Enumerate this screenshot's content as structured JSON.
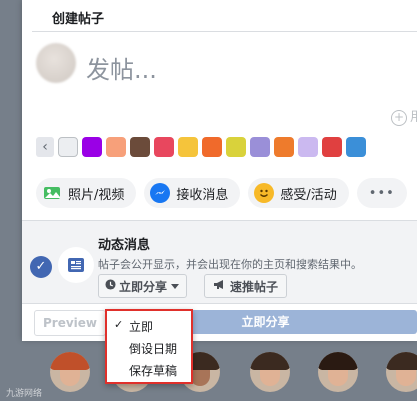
{
  "dialog": {
    "title": "创建帖子",
    "post_placeholder": "发帖...",
    "tag_hint": "用"
  },
  "backgrounds": {
    "prev_arrow": "‹",
    "swatches": [
      "#eceef1",
      "#9a00e6",
      "#f7a07a",
      "#6b4b3a",
      "#e8475e",
      "#f5c43b",
      "#f06a2b",
      "#d9d23b",
      "#9a8fd8",
      "#ee7b2c",
      "#cbb9f0",
      "#e04040",
      "#3b8fd8"
    ]
  },
  "actions": [
    {
      "label": "照片/视频",
      "icon": "photo-icon",
      "color": "#45bd62"
    },
    {
      "label": "接收消息",
      "icon": "messenger-icon",
      "color": "#1877f2"
    },
    {
      "label": "感受/活动",
      "icon": "smiley-icon",
      "color": "#f7b928"
    },
    {
      "label": "•••",
      "icon": "more-icon"
    }
  ],
  "feed": {
    "title": "动态消息",
    "description": "帖子会公开显示，并会出现在你的主页和搜索结果中。",
    "share_select": "立即分享",
    "boost": "速推帖子"
  },
  "footer": {
    "preview": "Preview",
    "share_now": "立即分享"
  },
  "dropdown": {
    "items": [
      {
        "label": "立即",
        "checked": true
      },
      {
        "label": "倒设日期",
        "checked": false
      },
      {
        "label": "保存草稿",
        "checked": false
      }
    ],
    "check_mark": "✓"
  },
  "watermark": "九游网络"
}
